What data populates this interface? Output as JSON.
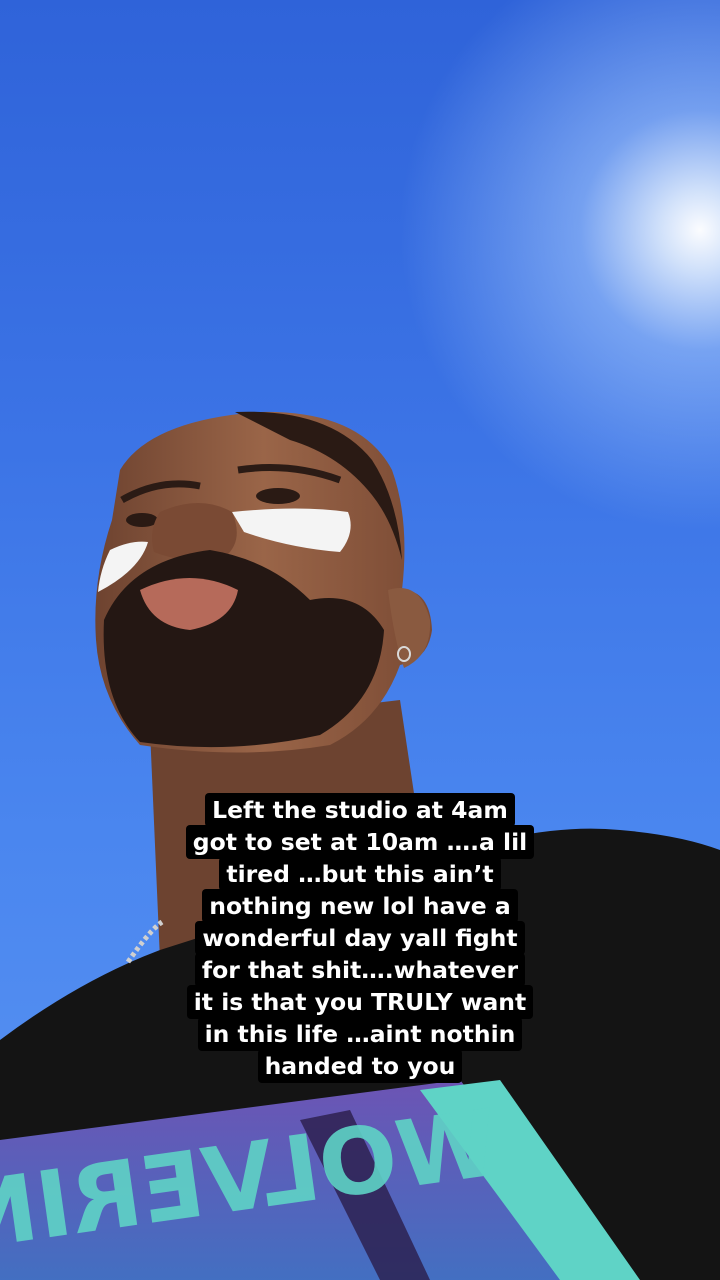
{
  "story": {
    "caption_lines": [
      "Left the studio at 4am",
      "got to set at 10am ….a lil",
      "tired …but this ain’t",
      "nothing new lol have a",
      "wonderful day yall fight",
      "for that shit….whatever",
      "it is that you TRULY want",
      "in this life …aint nothin",
      "handed to you"
    ],
    "shirt_print_text": "WOLVERINE"
  },
  "colors": {
    "sky_top": "#2f63d9",
    "sky_bottom": "#5a94f2",
    "sun": "#ffffff",
    "skin": "#8a5a40",
    "shirt": "#141414",
    "print_teal": "#5fd3c6",
    "print_purple": "#6a4fb8",
    "caption_bg": "#000000",
    "caption_text": "#ffffff"
  }
}
